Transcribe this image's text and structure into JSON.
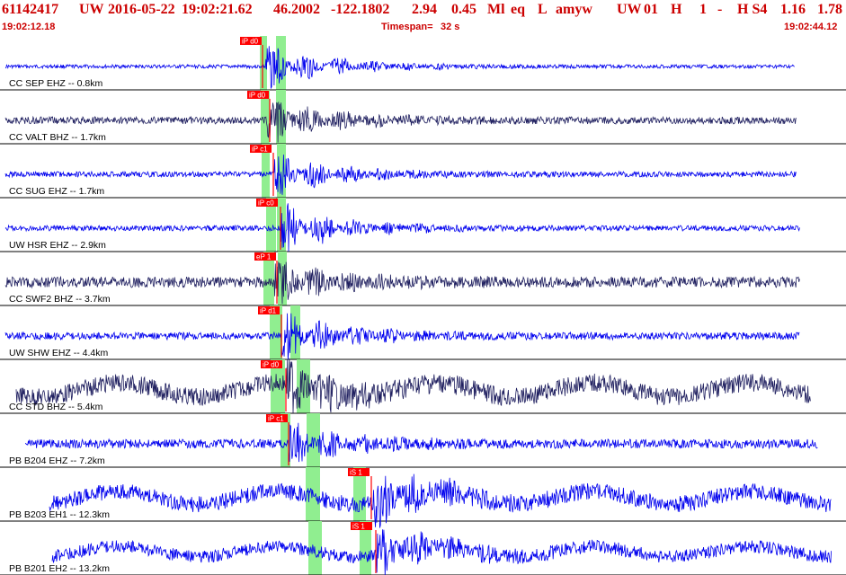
{
  "header": {
    "event_id": "61142417",
    "network": "UW",
    "date": "2016-05-22",
    "origin_time": "19:02:21.62",
    "latitude": "46.2002",
    "longitude": "-122.1802",
    "depth": "2.94",
    "magnitude": "0.45",
    "mag_type": "Ml",
    "event_type": "eq",
    "flag": "L",
    "analyst": "amyw",
    "author_net": "UW",
    "version": "01",
    "quality": "H",
    "count": "1",
    "dash": "-",
    "solution": "H S4",
    "rms": "1.16",
    "err": "1.78",
    "start_time": "19:02:12.18",
    "timespan_label": "Timespan=",
    "timespan_value": "32 s",
    "end_time": "19:02:44.12"
  },
  "colors": {
    "header_text": "#cc0000",
    "trace_blue": "#0000ee",
    "trace_navy": "#202060",
    "pick_flag": "#ff0000",
    "pick_window": "#90ee90"
  },
  "channels": [
    {
      "label": "CC SEP EHZ -- 0.8km",
      "color": "#0000ee",
      "picks": [
        {
          "label": "iP d0",
          "t": 0.0
        }
      ]
    },
    {
      "label": "CC VALT BHZ -- 1.7km",
      "color": "#202060",
      "picks": [
        {
          "label": "iP d0",
          "t": 0.0
        }
      ]
    },
    {
      "label": "CC SUG EHZ -- 1.7km",
      "color": "#0000ee",
      "picks": [
        {
          "label": "iP c1",
          "t": 0.0
        }
      ]
    },
    {
      "label": "UW HSR EHZ -- 2.9km",
      "color": "#0000ee",
      "picks": [
        {
          "label": "iP c0",
          "t": 0.0
        }
      ]
    },
    {
      "label": "CC SWF2 BHZ -- 3.7km",
      "color": "#202060",
      "picks": [
        {
          "label": "eP 1",
          "t": 0.0
        }
      ]
    },
    {
      "label": "UW SHW EHZ -- 4.4km",
      "color": "#0000ee",
      "picks": [
        {
          "label": "iP d1",
          "t": 0.0
        }
      ]
    },
    {
      "label": "CC STD BHZ -- 5.4km",
      "color": "#202060",
      "picks": [
        {
          "label": "iP d0",
          "t": 0.0
        }
      ]
    },
    {
      "label": "PB B204 EHZ -- 7.2km",
      "color": "#0000ee",
      "picks": [
        {
          "label": "iP c1",
          "t": 0.0
        }
      ]
    },
    {
      "label": "PB B203 EH1 -- 12.3km",
      "color": "#0000ee",
      "picks": [
        {
          "label": "iS 1",
          "t": 0.0
        }
      ]
    },
    {
      "label": "PB B201 EH2 -- 13.2km",
      "color": "#0000ee",
      "picks": [
        {
          "label": "iS 1",
          "t": 0.0
        }
      ]
    }
  ]
}
